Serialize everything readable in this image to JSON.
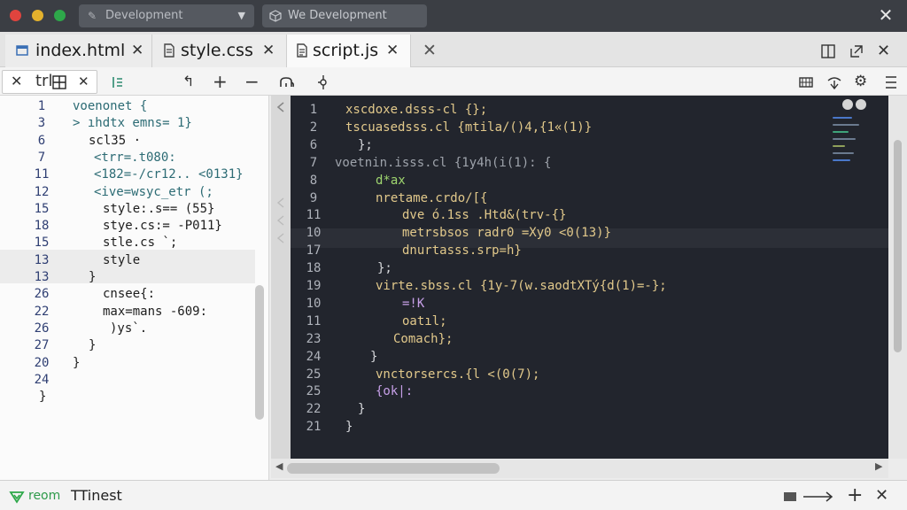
{
  "titlebar": {
    "workspace_select": "Development",
    "project_label": "We Development",
    "close_glyph": "✕"
  },
  "tabs": [
    {
      "label": "index.html",
      "icon": "html-file-icon",
      "close": "✕",
      "active": false
    },
    {
      "label": "style.css",
      "icon": "css-file-icon",
      "close": "✕",
      "active": false
    },
    {
      "label": "script.js",
      "icon": "js-file-icon",
      "close": "✕",
      "active": true
    }
  ],
  "tab_extra_close": "✕",
  "toolbar": {
    "panel_label": "trl",
    "panel_close": "✕"
  },
  "left_editor": {
    "lines": [
      {
        "num": "1",
        "code": "voenonet {"
      },
      {
        "num": "3",
        "code": "> ıhdtx emns= 1}"
      },
      {
        "num": "6",
        "code": "scl35 ·"
      },
      {
        "num": "7",
        "code": "<trr=.t080:"
      },
      {
        "num": "11",
        "code": "<182=-/cr12.. <0131}"
      },
      {
        "num": "12",
        "code": "<ive=wsyc_etr (;"
      },
      {
        "num": "15",
        "code": "style:.s== (55}"
      },
      {
        "num": "18",
        "code": "stye.cs:= -P011}"
      },
      {
        "num": "15",
        "code": "stle.cs `;"
      },
      {
        "num": "13",
        "code": "style"
      },
      {
        "num": "13",
        "code": "}"
      },
      {
        "num": "26",
        "code": "cnsee{:"
      },
      {
        "num": "22",
        "code": "max=mans -609:"
      },
      {
        "num": "26",
        "code": ")ys`."
      },
      {
        "num": "27",
        "code": "}"
      },
      {
        "num": "20",
        "code": "}"
      },
      {
        "num": "24",
        "code": ""
      },
      {
        "num": "",
        "code": "}"
      }
    ]
  },
  "right_editor": {
    "lines": [
      {
        "num": "1",
        "code": "xscdoxe.dsss-cl {};"
      },
      {
        "num": "2",
        "code": "tscuasedsss.cl {mtila/()4,{1«(1)}"
      },
      {
        "num": "6",
        "code": "};"
      },
      {
        "num": "7",
        "code": "voetnin.isss.cl {1y4h(i(1): {"
      },
      {
        "num": "8",
        "code": "d*ax"
      },
      {
        "num": "9",
        "code": "nretame.crdo/[{"
      },
      {
        "num": "11",
        "code": "dve ó.1ss .Htd&(trv-{}"
      },
      {
        "num": "10",
        "code": "metrsbsos radr0 =Xy0 <0(13)}"
      },
      {
        "num": "17",
        "code": "dnurtasss.srp=h}"
      },
      {
        "num": "18",
        "code": "};"
      },
      {
        "num": "19",
        "code": "virte.sbss.cl {1y-7(w.saodtXTý{d(1)=-};"
      },
      {
        "num": "10",
        "code": "=!K"
      },
      {
        "num": "11",
        "code": "oatıl;"
      },
      {
        "num": "23",
        "code": "Comach};"
      },
      {
        "num": "24",
        "code": "}"
      },
      {
        "num": "25",
        "code": "vnctorsercs.{l <(0(7);"
      },
      {
        "num": "25",
        "code": "{ok|:"
      },
      {
        "num": "22",
        "code": "}"
      },
      {
        "num": "21",
        "code": "}"
      }
    ]
  },
  "statusbar": {
    "branch_label": "reom",
    "status_text": "TTinest"
  },
  "colors": {
    "editor_bg": "#22252d",
    "titlebar_bg": "#3b3e44",
    "accent_green": "#2ea84a"
  }
}
